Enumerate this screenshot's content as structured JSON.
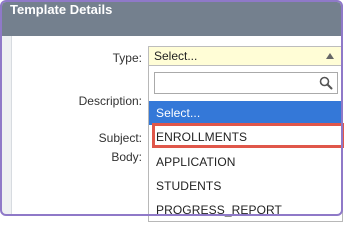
{
  "panel": {
    "title": "Template Details"
  },
  "form": {
    "type_label": "Type:",
    "description_label": "Description:",
    "subject_label": "Subject:",
    "body_label": "Body:",
    "type_value": "Select..."
  },
  "dropdown": {
    "search_value": "",
    "search_placeholder": "",
    "options": [
      "Select...",
      "ENROLLMENTS",
      "APPLICATION",
      "STUDENTS",
      "PROGRESS_REPORT"
    ],
    "selected_index": 0,
    "highlighted_option": "ENROLLMENTS"
  },
  "colors": {
    "header_bg": "#74808e",
    "selected_bg": "#3478d8",
    "highlight_border": "#e0574a",
    "select_bg": "#fffdd6"
  }
}
